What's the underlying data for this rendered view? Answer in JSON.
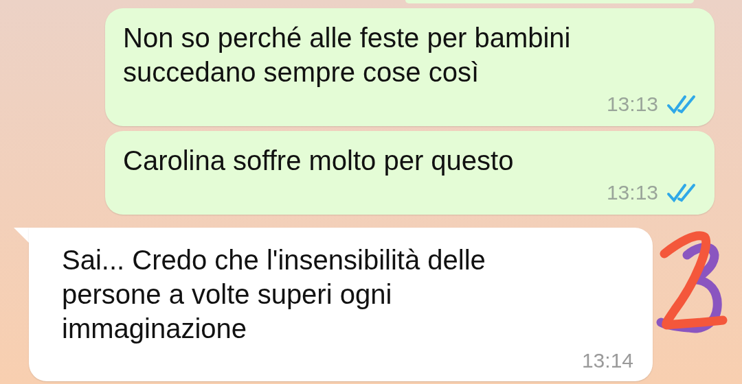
{
  "messages": [
    {
      "kind": "outgoing",
      "text": "Non so perché alle feste per bambini succedano sempre cose così",
      "time": "13:13",
      "read": true
    },
    {
      "kind": "outgoing",
      "text": "Carolina soffre molto per questo",
      "time": "13:13",
      "read": true
    },
    {
      "kind": "incoming",
      "text": "Sai... Credo che l'insensibilità delle persone a volte superi ogni immaginazione",
      "time": "13:14"
    }
  ]
}
